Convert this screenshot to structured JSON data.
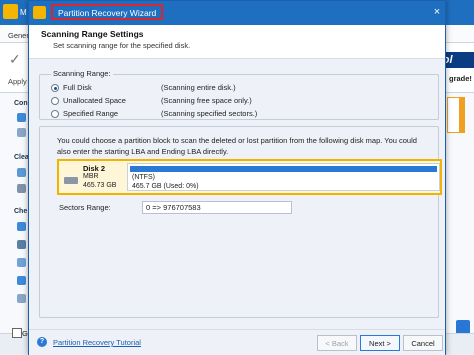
{
  "background_app": {
    "title_fragment": "M",
    "menu_label": "Gener",
    "apply_label": "Apply",
    "brand_fragment": "ool",
    "upgrade_label": "grade!",
    "sidebar_fragments": [
      "Con",
      "Clea",
      "Che"
    ],
    "bottom_fragment": "G"
  },
  "dialog": {
    "title": "Partition Recovery Wizard",
    "close_icon": "×",
    "heading": "Scanning Range Settings",
    "subheading": "Set scanning range for the specified disk.",
    "scanning_range": {
      "legend": "Scanning Range:",
      "options": [
        {
          "label": "Full Disk",
          "description": "(Scanning entire disk.)",
          "checked": true
        },
        {
          "label": "Unallocated Space",
          "description": "(Scanning free space only.)",
          "checked": false
        },
        {
          "label": "Specified Range",
          "description": "(Scanning specified sectors.)",
          "checked": false
        }
      ]
    },
    "disk_map": {
      "note": "You could choose a partition block to scan the deleted or lost partition from the following disk map. You could also enter the starting LBA and Ending LBA directly.",
      "disk": {
        "name": "Disk 2",
        "type": "MBR",
        "size": "465.73 GB"
      },
      "partition": {
        "filesystem": "(NTFS)",
        "usage": "465.7 GB (Used: 0%)",
        "bar_fill_fraction": 1.0,
        "bar_color": "#2a7ad5"
      }
    },
    "sectors_range": {
      "label": "Sectors Range:",
      "value": "0 => 976707583"
    },
    "footer": {
      "help_icon": "?",
      "tutorial_link": "Partition Recovery Tutorial",
      "back_label": "< Back",
      "next_label": "Next >",
      "cancel_label": "Cancel"
    }
  },
  "colors": {
    "titlebar": "#1f6fc1",
    "title_highlight": "#d9262f",
    "selected_disk_border": "#f0b400",
    "link": "#1a5fb4"
  }
}
